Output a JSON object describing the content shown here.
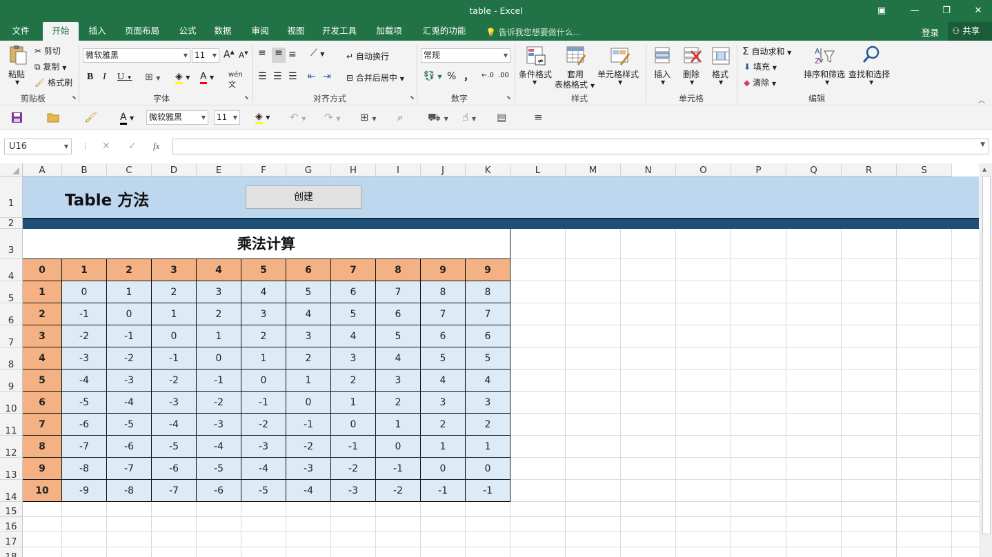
{
  "window": {
    "title": "table - Excel",
    "min": "—",
    "restore": "❐",
    "close": "✕",
    "ribbon_opts": "▣"
  },
  "menu": {
    "tabs": [
      "文件",
      "开始",
      "插入",
      "页面布局",
      "公式",
      "数据",
      "审阅",
      "视图",
      "开发工具",
      "加载项",
      "汇兎的功能"
    ],
    "active_index": 1,
    "tell_me": "告诉我您想要做什么...",
    "login": "登录",
    "share": "共享"
  },
  "ribbon": {
    "clipboard": {
      "paste": "粘贴",
      "cut": "剪切",
      "copy": "复制",
      "painter": "格式刷",
      "label": "剪贴板"
    },
    "font": {
      "name": "微软雅黑",
      "size": "11",
      "grow": "A",
      "shrink": "A",
      "bold": "B",
      "italic": "I",
      "underline": "U",
      "label": "字体",
      "wen": "wén"
    },
    "alignment": {
      "wrap": "自动换行",
      "merge": "合并后居中",
      "label": "对齐方式"
    },
    "number": {
      "format": "常规",
      "percent": "%",
      "comma": "，",
      "label": "数字"
    },
    "styles": {
      "cond": "条件格式",
      "table1": "套用",
      "table2": "表格格式",
      "cell": "单元格样式",
      "label": "样式"
    },
    "cells": {
      "insert": "插入",
      "delete": "删除",
      "format": "格式",
      "label": "单元格"
    },
    "editing": {
      "autosum": "自动求和",
      "fill": "填充",
      "clear": "清除",
      "sort": "排序和筛选",
      "find": "查找和选择",
      "label": "编辑"
    }
  },
  "qat": {
    "font": "微软雅黑",
    "size": "11"
  },
  "formula": {
    "namebox": "U16",
    "fx": "fx",
    "cancel": "✕",
    "confirm": "✓"
  },
  "colors": {
    "accent": "#217346",
    "hdr_cell": "#f4b183",
    "val_cell": "#ddebf7",
    "banner": "#bdd7ee",
    "bar": "#1f4e79"
  },
  "sheet": {
    "columns": [
      "A",
      "B",
      "C",
      "D",
      "E",
      "F",
      "G",
      "H",
      "I",
      "J",
      "K",
      "L",
      "M",
      "N",
      "O",
      "P",
      "Q",
      "R",
      "S"
    ],
    "rows": [
      "1",
      "2",
      "3",
      "4",
      "5",
      "6",
      "7",
      "8",
      "9",
      "10",
      "11",
      "12",
      "13",
      "14",
      "15",
      "16",
      "17",
      "18"
    ],
    "banner_title": "Table 方法",
    "create_button": "创建",
    "table_title": "乘法计算",
    "header_row": [
      "0",
      "1",
      "2",
      "3",
      "4",
      "5",
      "6",
      "7",
      "8",
      "9",
      "9"
    ],
    "row_labels": [
      "1",
      "2",
      "3",
      "4",
      "5",
      "6",
      "7",
      "8",
      "9",
      "10"
    ],
    "values": [
      [
        "0",
        "1",
        "2",
        "3",
        "4",
        "5",
        "6",
        "7",
        "8",
        "8"
      ],
      [
        "-1",
        "0",
        "1",
        "2",
        "3",
        "4",
        "5",
        "6",
        "7",
        "7"
      ],
      [
        "-2",
        "-1",
        "0",
        "1",
        "2",
        "3",
        "4",
        "5",
        "6",
        "6"
      ],
      [
        "-3",
        "-2",
        "-1",
        "0",
        "1",
        "2",
        "3",
        "4",
        "5",
        "5"
      ],
      [
        "-4",
        "-3",
        "-2",
        "-1",
        "0",
        "1",
        "2",
        "3",
        "4",
        "4"
      ],
      [
        "-5",
        "-4",
        "-3",
        "-2",
        "-1",
        "0",
        "1",
        "2",
        "3",
        "3"
      ],
      [
        "-6",
        "-5",
        "-4",
        "-3",
        "-2",
        "-1",
        "0",
        "1",
        "2",
        "2"
      ],
      [
        "-7",
        "-6",
        "-5",
        "-4",
        "-3",
        "-2",
        "-1",
        "0",
        "1",
        "1"
      ],
      [
        "-8",
        "-7",
        "-6",
        "-5",
        "-4",
        "-3",
        "-2",
        "-1",
        "0",
        "0"
      ],
      [
        "-9",
        "-8",
        "-7",
        "-6",
        "-5",
        "-4",
        "-3",
        "-2",
        "-1",
        "-1"
      ]
    ]
  }
}
